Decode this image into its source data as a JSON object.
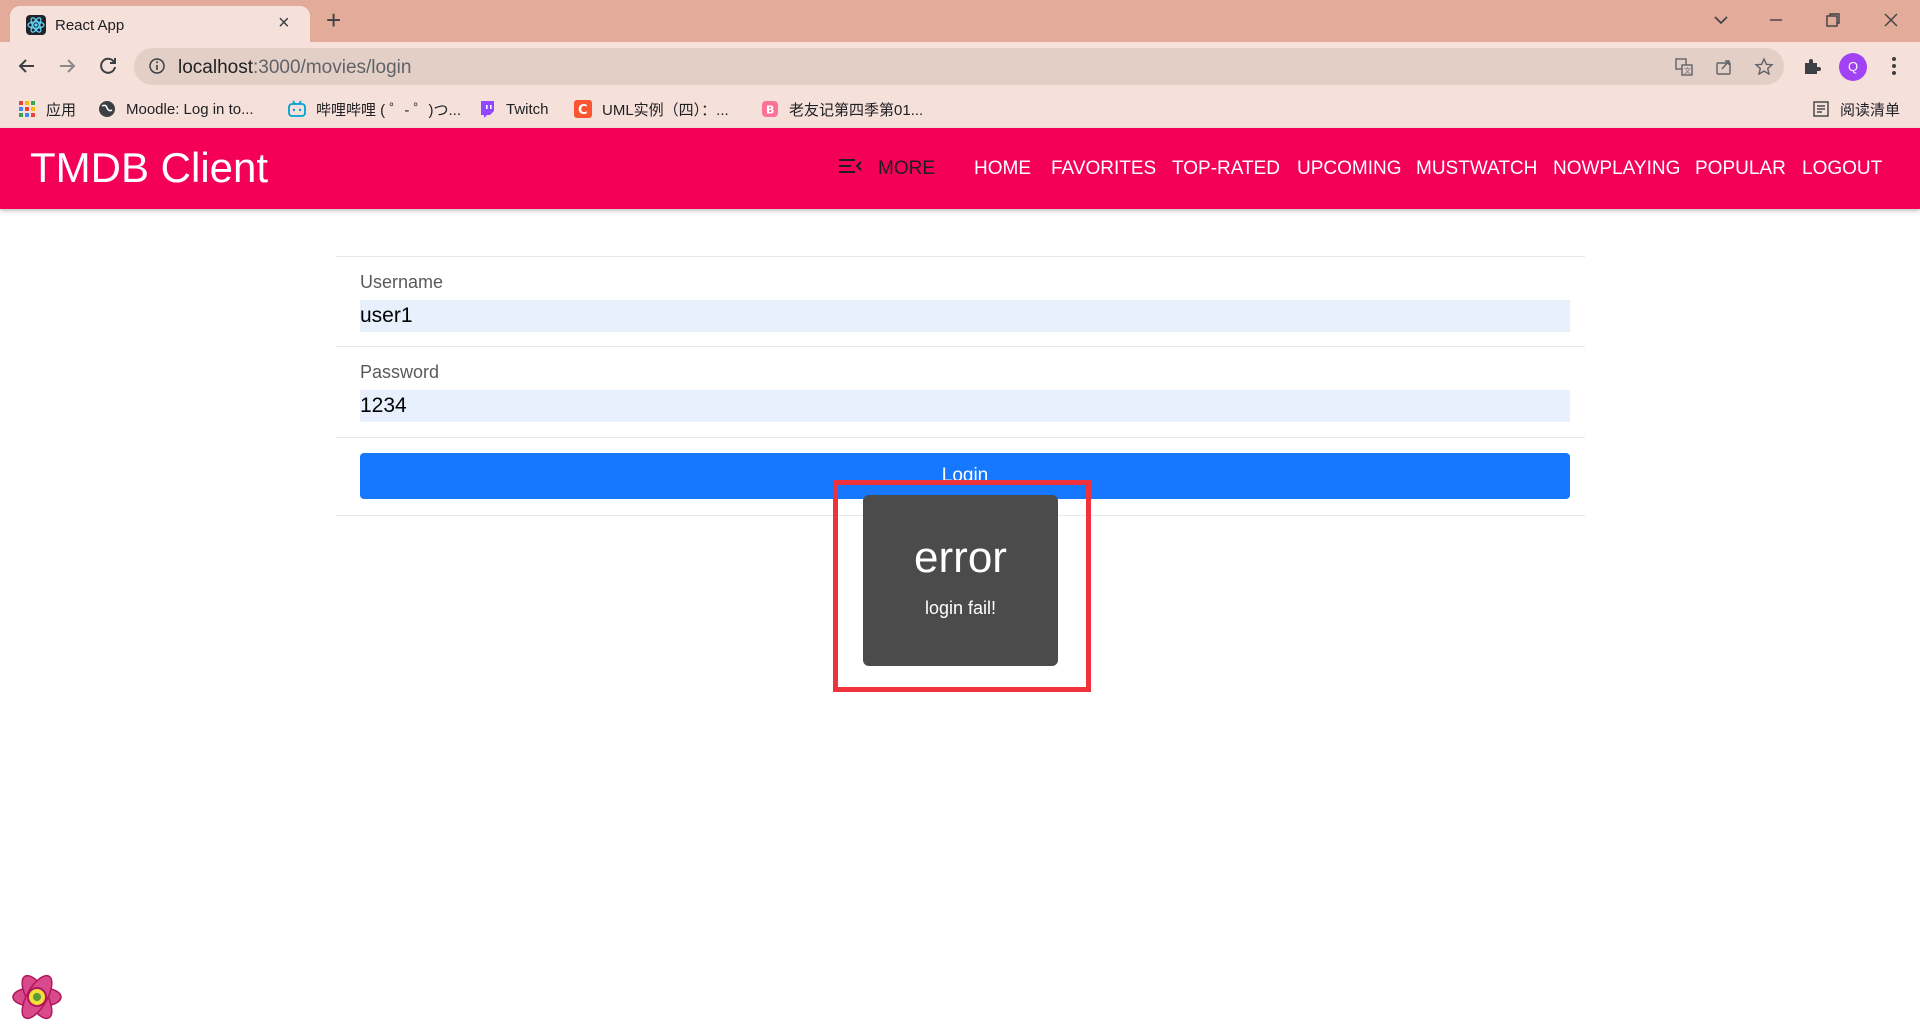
{
  "browser": {
    "tab_title": "React App",
    "url_host": "localhost",
    "url_path": ":3000/movies/login",
    "profile_initial": "Q",
    "bookmarks": [
      {
        "label": "应用",
        "icon": "apps-grid-icon"
      },
      {
        "label": "Moodle: Log in to...",
        "icon": "globe-icon"
      },
      {
        "label": "哔哩哔哩 ( ゜- ゜)つ...",
        "icon": "bilibili-icon"
      },
      {
        "label": "Twitch",
        "icon": "twitch-icon"
      },
      {
        "label": "UML实例（四）：...",
        "icon": "csdn-icon"
      },
      {
        "label": "老友记第四季第01...",
        "icon": "bilibili-pink-icon"
      }
    ],
    "reading_list": "阅读清单"
  },
  "navbar": {
    "brand": "TMDB Client",
    "more_label": "MORE",
    "links": [
      "HOME",
      "FAVORITES",
      "TOP-RATED",
      "UPCOMING",
      "MUSTWATCH",
      "NOWPLAYING",
      "POPULAR",
      "LOGOUT"
    ]
  },
  "form": {
    "username_label": "Username",
    "username_value": "user1",
    "password_label": "Password",
    "password_value": "1234",
    "submit_label": "Login"
  },
  "toast": {
    "title": "error",
    "message": "login fail!"
  },
  "colors": {
    "navbar": "#f50057",
    "primary_button": "#1677ff",
    "toast_bg": "#4b4b4b",
    "highlight": "#f0323c"
  }
}
